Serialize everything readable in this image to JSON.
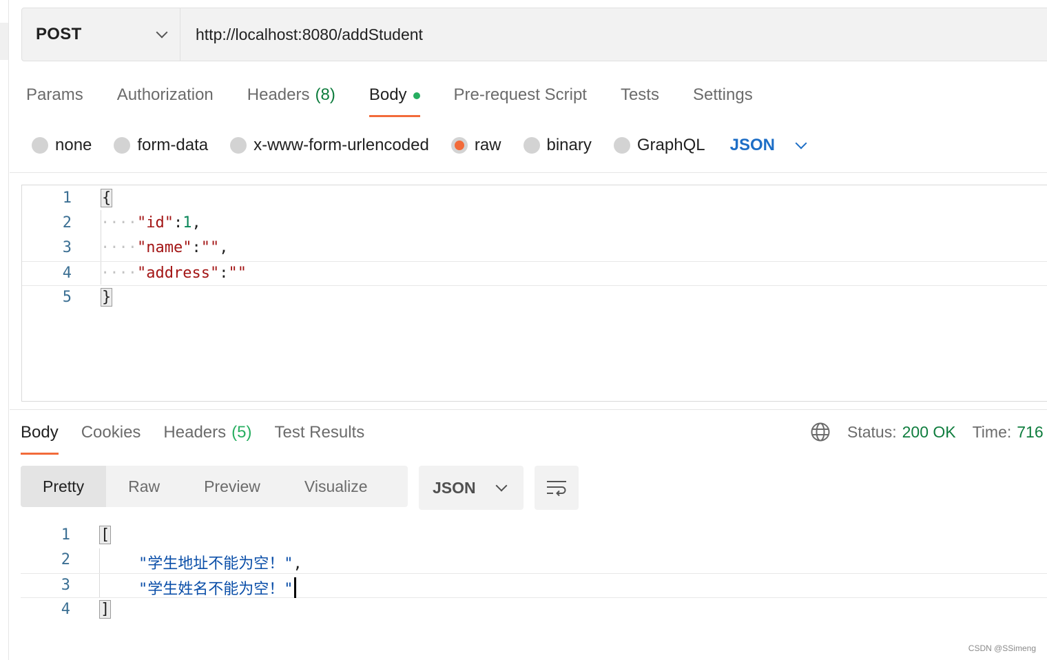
{
  "request": {
    "method": "POST",
    "url": "http://localhost:8080/addStudent"
  },
  "request_tabs": [
    {
      "label": "Params"
    },
    {
      "label": "Authorization"
    },
    {
      "label": "Headers",
      "count": "(8)"
    },
    {
      "label": "Body",
      "active": true
    },
    {
      "label": "Pre-request Script"
    },
    {
      "label": "Tests"
    },
    {
      "label": "Settings"
    }
  ],
  "body_types": {
    "none": "none",
    "form_data": "form-data",
    "urlencoded": "x-www-form-urlencoded",
    "raw": "raw",
    "binary": "binary",
    "graphql": "GraphQL",
    "selected": "raw",
    "format": "JSON"
  },
  "request_body": {
    "line_numbers": [
      "1",
      "2",
      "3",
      "4",
      "5"
    ],
    "open_brace": "{",
    "close_brace": "}",
    "key_id": "\"id\"",
    "val_id": "1",
    "key_name": "\"name\"",
    "val_name": "\"\"",
    "key_address": "\"address\"",
    "val_address": "\"\"",
    "colon": ":",
    "comma": ",",
    "indent": "····"
  },
  "response_tabs": [
    {
      "label": "Body",
      "active": true
    },
    {
      "label": "Cookies"
    },
    {
      "label": "Headers",
      "count": "(5)"
    },
    {
      "label": "Test Results"
    }
  ],
  "response_status": {
    "status_label": "Status:",
    "status_value": "200 OK",
    "time_label": "Time:",
    "time_value": "716"
  },
  "response_views": [
    "Pretty",
    "Raw",
    "Preview",
    "Visualize"
  ],
  "response_format": "JSON",
  "response_body": {
    "line_numbers": [
      "1",
      "2",
      "3",
      "4"
    ],
    "open_bracket": "[",
    "close_bracket": "]",
    "msg1": "\"学生地址不能为空！\"",
    "msg2": "\"学生姓名不能为空！\"",
    "comma": ","
  },
  "watermark": "CSDN @SSimeng",
  "colors": {
    "accent": "#f26b3a",
    "success": "#0f7d3e",
    "link": "#1d6ec6"
  }
}
